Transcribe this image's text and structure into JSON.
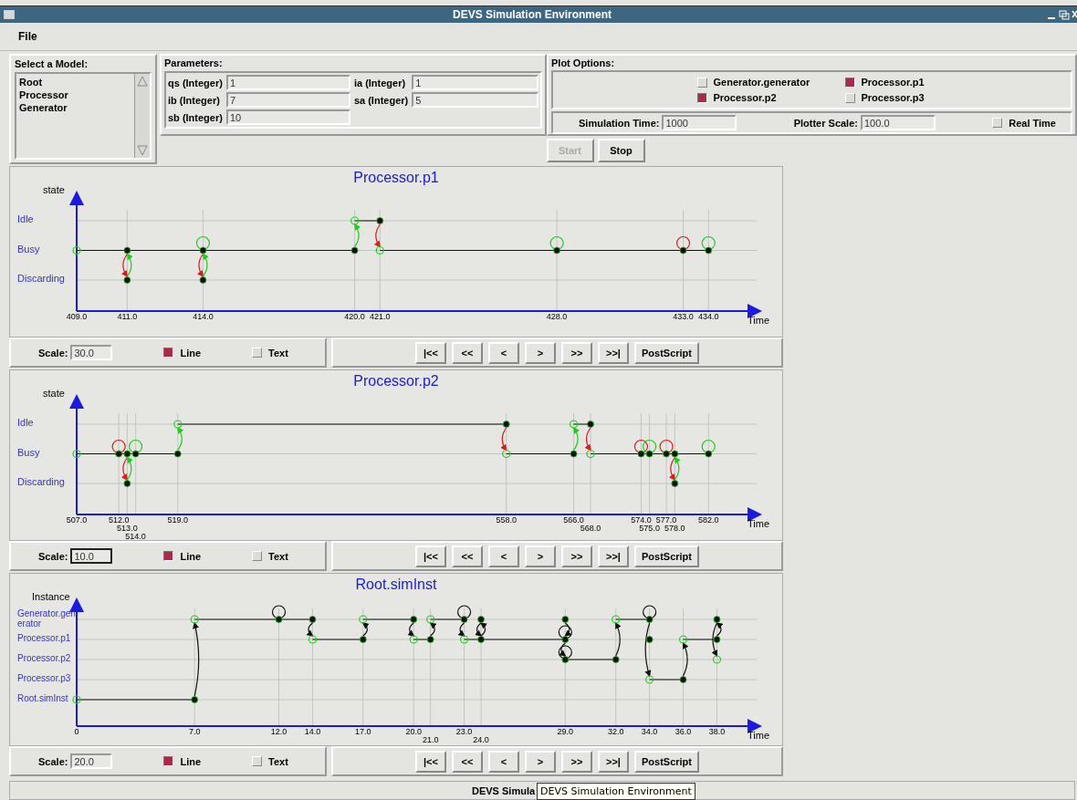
{
  "window": {
    "title": "DEVS Simulation Environment"
  },
  "menu": [
    {
      "label": "File"
    }
  ],
  "model_list": {
    "title": "Select a Model:",
    "items": [
      "Root",
      "Processor",
      "Generator"
    ]
  },
  "parameters": {
    "title": "Parameters:",
    "fields": [
      {
        "label": "qs (Integer)",
        "value": "1"
      },
      {
        "label": "ia (Integer)",
        "value": "1"
      },
      {
        "label": "ib (Integer)",
        "value": "7"
      },
      {
        "label": "sa (Integer)",
        "value": "5"
      },
      {
        "label": "sb (Integer)",
        "value": "10"
      }
    ]
  },
  "plot_options": {
    "title": "Plot Options:",
    "plots": [
      {
        "label": "Generator.generator",
        "checked": false
      },
      {
        "label": "Processor.p1",
        "checked": true
      },
      {
        "label": "Processor.p2",
        "checked": true
      },
      {
        "label": "Processor.p3",
        "checked": false
      }
    ],
    "simulation_time": {
      "label": "Simulation Time:",
      "value": "1000"
    },
    "plotter_scale": {
      "label": "Plotter Scale:",
      "value": "100.0"
    },
    "real_time": {
      "label": "Real Time",
      "checked": false
    }
  },
  "buttons": [
    {
      "label": "Start",
      "disabled": true
    },
    {
      "label": "Stop",
      "disabled": false
    }
  ],
  "plots": [
    {
      "title": "Processor.p1",
      "y_axis_label": "state",
      "x_axis_label": "Time",
      "states": [
        "Idle",
        "Busy",
        "Discarding"
      ],
      "ticks": [
        "409.0",
        "411.0",
        "414.0",
        "420.0",
        "421.0",
        "428.0",
        "433.0",
        "434.0"
      ],
      "scale": {
        "label": "Scale:",
        "value": "30.0",
        "focused": false
      },
      "line": {
        "label": "Line",
        "checked": true
      },
      "text": {
        "label": "Text",
        "checked": false
      },
      "nav_buttons": [
        "|<<",
        "<<",
        "<",
        ">",
        ">>",
        ">>|",
        "PostScript"
      ]
    },
    {
      "title": "Processor.p2",
      "y_axis_label": "state",
      "x_axis_label": "Time",
      "states": [
        "Idle",
        "Busy",
        "Discarding"
      ],
      "ticks": [
        "507.0",
        "512.0",
        "513.0",
        "514.0",
        "519.0",
        "558.0",
        "566.0",
        "568.0",
        "574.0",
        "575.0",
        "577.0",
        "578.0",
        "582.0"
      ],
      "scale": {
        "label": "Scale:",
        "value": "10.0",
        "focused": true
      },
      "line": {
        "label": "Line",
        "checked": true
      },
      "text": {
        "label": "Text",
        "checked": false
      },
      "nav_buttons": [
        "|<<",
        "<<",
        "<",
        ">",
        ">>",
        ">>|",
        "PostScript"
      ]
    },
    {
      "title": "Root.simInst",
      "y_axis_label": "Instance",
      "x_axis_label": "Time",
      "states": [
        "Generator.generator",
        "Processor.p1",
        "Processor.p2",
        "Processor.p3",
        "Root.simInst"
      ],
      "ticks": [
        "0",
        "7.0",
        "12.0",
        "14.0",
        "17.0",
        "20.0",
        "21.0",
        "23.0",
        "24.0",
        "29.0",
        "32.0",
        "34.0",
        "36.0",
        "38.0"
      ],
      "scale": {
        "label": "Scale:",
        "value": "20.0",
        "focused": false
      },
      "line": {
        "label": "Line",
        "checked": true
      },
      "text": {
        "label": "Text",
        "checked": false
      },
      "nav_buttons": [
        "|<<",
        "<<",
        "<",
        ">",
        ">>",
        ">>|",
        "PostScript"
      ]
    }
  ],
  "status_bar": {
    "text": "DEVS Simula"
  },
  "tooltip": "DEVS Simulation Environment"
}
